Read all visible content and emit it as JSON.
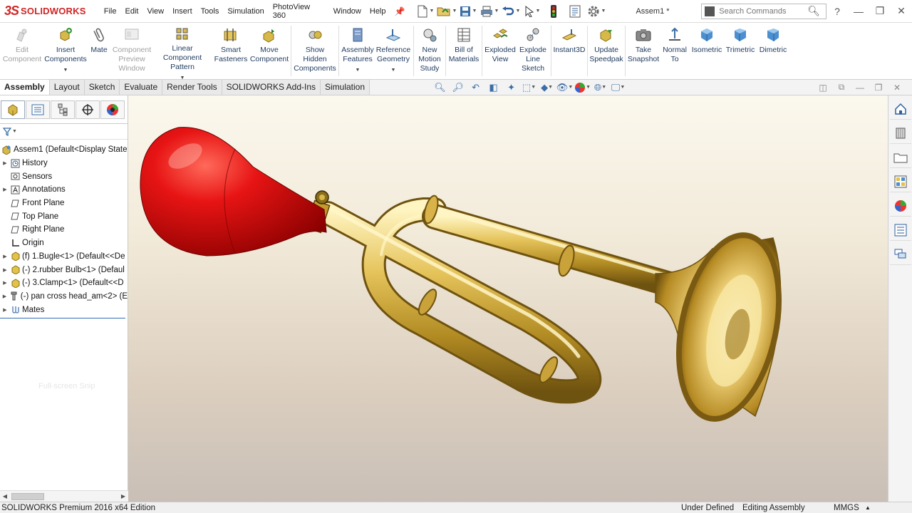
{
  "app": {
    "logo_prefix": "3S",
    "logo_text": "SOLIDWORKS",
    "document_title": "Assem1 *"
  },
  "menu": [
    "File",
    "Edit",
    "View",
    "Insert",
    "Tools",
    "Simulation",
    "PhotoView 360",
    "Window",
    "Help"
  ],
  "search": {
    "placeholder": "Search Commands"
  },
  "ribbon": {
    "edit_component": "Edit Component",
    "insert_components": "Insert Components",
    "mate": "Mate",
    "component_preview": "Component Preview Window",
    "linear_pattern": "Linear Component Pattern",
    "smart_fasteners": "Smart Fasteners",
    "move_component": "Move Component",
    "show_hidden": "Show Hidden Components",
    "assembly_features": "Assembly Features",
    "reference_geometry": "Reference Geometry",
    "new_motion_study": "New Motion Study",
    "bill_of_materials": "Bill of Materials",
    "exploded_view": "Exploded View",
    "explode_line_sketch": "Explode Line Sketch",
    "instant3d": "Instant3D",
    "update_speedpak": "Update Speedpak",
    "take_snapshot": "Take Snapshot",
    "normal_to": "Normal To",
    "isometric": "Isometric",
    "trimetric": "Trimetric",
    "dimetric": "Dimetric"
  },
  "tabs": [
    "Assembly",
    "Layout",
    "Sketch",
    "Evaluate",
    "Render Tools",
    "SOLIDWORKS Add-Ins",
    "Simulation"
  ],
  "tree": {
    "root": "Assem1  (Default<Display State-",
    "items": [
      "History",
      "Sensors",
      "Annotations",
      "Front Plane",
      "Top Plane",
      "Right Plane",
      "Origin",
      "(f) 1.Bugle<1> (Default<<De",
      "(-) 2.rubber Bulb<1> (Defaul",
      "(-) 3.Clamp<1> (Default<<D",
      "(-) pan cross head_am<2> (E",
      "Mates"
    ]
  },
  "ghost_text": "Full-screen Snip",
  "status": {
    "edition": "SOLIDWORKS Premium 2016 x64 Edition",
    "defined": "Under Defined",
    "mode": "Editing Assembly",
    "units": "MMGS",
    "units_caret": "▲"
  },
  "colors": {
    "brand": "#d02626",
    "bulb": "#e01010",
    "brass": "#d8b640",
    "accent": "#2f6eb5"
  }
}
